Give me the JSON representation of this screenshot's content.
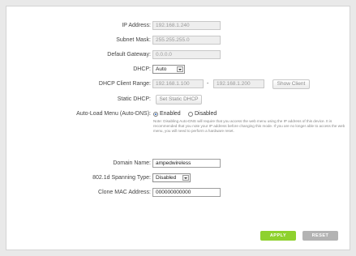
{
  "ip_address": {
    "label": "IP Address:",
    "value": "192.168.1.240"
  },
  "subnet_mask": {
    "label": "Subnet Mask:",
    "value": "255.255.255.0"
  },
  "default_gateway": {
    "label": "Default Gateway:",
    "value": "0.0.0.0"
  },
  "dhcp": {
    "label": "DHCP:",
    "selected": "Auto"
  },
  "dhcp_range": {
    "label": "DHCP Client Range:",
    "start": "192.168.1.100",
    "separator": "-",
    "end": "192.168.1.200",
    "show_client_label": "Show Client"
  },
  "static_dhcp": {
    "label": "Static DHCP:",
    "button_label": "Set Static DHCP"
  },
  "auto_dns": {
    "label": "Auto-Load Menu (Auto-DNS):",
    "enabled_label": "Enabled",
    "disabled_label": "Disabled",
    "selected": "Enabled",
    "note": "Note: Disabling Auto-DNS will require that you access the web menu using the IP address of this device. It is recommended that you note your IP address before changing this mode. If you are no longer able to access the web menu, you will need to perform a hardware reset."
  },
  "domain_name": {
    "label": "Domain Name:",
    "value": "ampedwireless"
  },
  "spanning_tree": {
    "label": "802.1d Spanning Type:",
    "selected": "Disabled"
  },
  "clone_mac": {
    "label": "Clone MAC Address:",
    "value": "000000000000"
  },
  "actions": {
    "apply_label": "APPLY",
    "reset_label": "RESET"
  },
  "colors": {
    "apply": "#8ed12e",
    "reset": "#b3b3b3",
    "background": "#e9e9e9"
  }
}
